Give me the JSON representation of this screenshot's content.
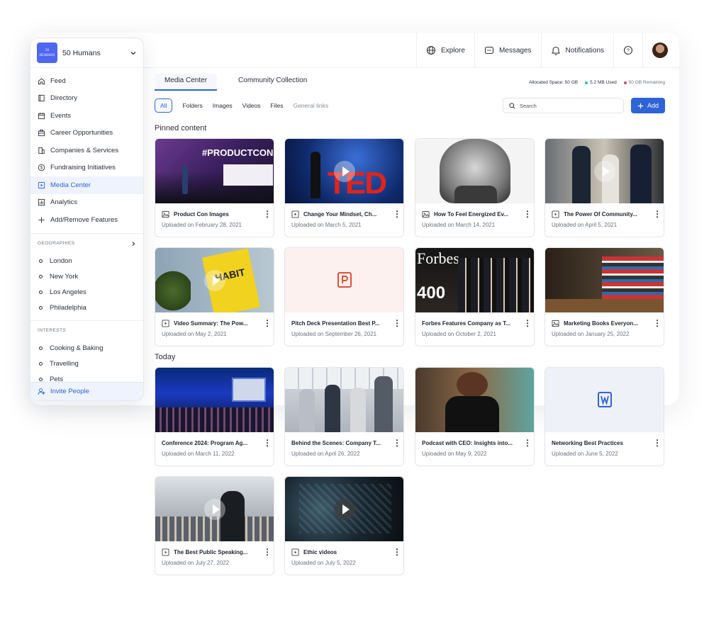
{
  "sidebar": {
    "org_logo_text": "50 HUMANS",
    "org_name": "50 Humans",
    "nav": [
      {
        "label": "Feed",
        "icon": "home-icon"
      },
      {
        "label": "Directory",
        "icon": "book-icon"
      },
      {
        "label": "Events",
        "icon": "calendar-icon"
      },
      {
        "label": "Career Opportunities",
        "icon": "briefcase-icon"
      },
      {
        "label": "Companies & Services",
        "icon": "building-icon"
      },
      {
        "label": "Fundraising Initiatives",
        "icon": "dollar-icon"
      },
      {
        "label": "Media Center",
        "icon": "media-icon",
        "active": true
      },
      {
        "label": "Analytics",
        "icon": "chart-icon"
      },
      {
        "label": "Add/Remove Features",
        "icon": "plus-icon"
      }
    ],
    "geographies_heading": "GEOGRAPHIES",
    "geographies": [
      "London",
      "New York",
      "Los Angeles",
      "Philadelphia"
    ],
    "interests_heading": "INTERESTS",
    "interests": [
      "Cooking & Baking",
      "Travelling",
      "Pets"
    ],
    "invite_label": "Invite People"
  },
  "topbar": {
    "explore": "Explore",
    "messages": "Messages",
    "notifications": "Notifications"
  },
  "tabs": [
    "Media Center",
    "Community Collection"
  ],
  "storage": {
    "allocated": "Allocated Space: 50 GB",
    "used": "5.2 MB Used",
    "remaining": "50 GB Remaining",
    "used_color": "#19c3b5",
    "remaining_color": "#e5484d"
  },
  "filters": [
    "All",
    "Folders",
    "Images",
    "Videos",
    "Files",
    "General links"
  ],
  "search_placeholder": "Search",
  "add_label": "Add",
  "accent": "#2f63d6",
  "sections": {
    "pinned": "Pinned content",
    "today": "Today"
  },
  "cards": [
    {
      "title": "Product Con Images",
      "date": "Uploaded on February 28, 2021",
      "type": "image"
    },
    {
      "title": "Change Your Mindset, Ch...",
      "date": "Uploaded on March 5, 2021",
      "type": "video"
    },
    {
      "title": "How To Feel Energized Ev...",
      "date": "Uploaded on March 14, 2021",
      "type": "image"
    },
    {
      "title": "The Power Of Community...",
      "date": "Uploaded on April 5, 2021",
      "type": "video"
    },
    {
      "title": "Video Summary: The Pow...",
      "date": "Uploaded on May 2, 2021",
      "type": "video"
    },
    {
      "title": "Pitch Deck Presentation Best P...",
      "date": "Uploaded on September 26, 2021",
      "type": "file"
    },
    {
      "title": "Forbes Features Company as T...",
      "date": "Uploaded on October 2, 2021",
      "type": "none"
    },
    {
      "title": "Marketing Books Everyon...",
      "date": "Uploaded on January 25, 2022",
      "type": "image"
    },
    {
      "title": "Conference 2024: Program Ag...",
      "date": "Uploaded on March 11, 2022",
      "type": "none"
    },
    {
      "title": "Behind the Scenes: Company T...",
      "date": "Uploaded on April 26, 2022",
      "type": "none"
    },
    {
      "title": "Podcast with CEO: Insights into...",
      "date": "Uploaded on May 9, 2022",
      "type": "none"
    },
    {
      "title": "Networking Best Practices",
      "date": "Uploaded on June 5, 2022",
      "type": "none"
    },
    {
      "title": "The Best Public Speaking...",
      "date": "Uploaded on July 27, 2022",
      "type": "video"
    },
    {
      "title": "Ethic videos",
      "date": "Uploaded on July 5, 2022",
      "type": "video"
    }
  ],
  "thumb_texts": {
    "productcon": "#PRODUCTCON",
    "ted": "TED",
    "habit": "HABIT",
    "forbes": "Forbes",
    "forbes_num": "400"
  }
}
